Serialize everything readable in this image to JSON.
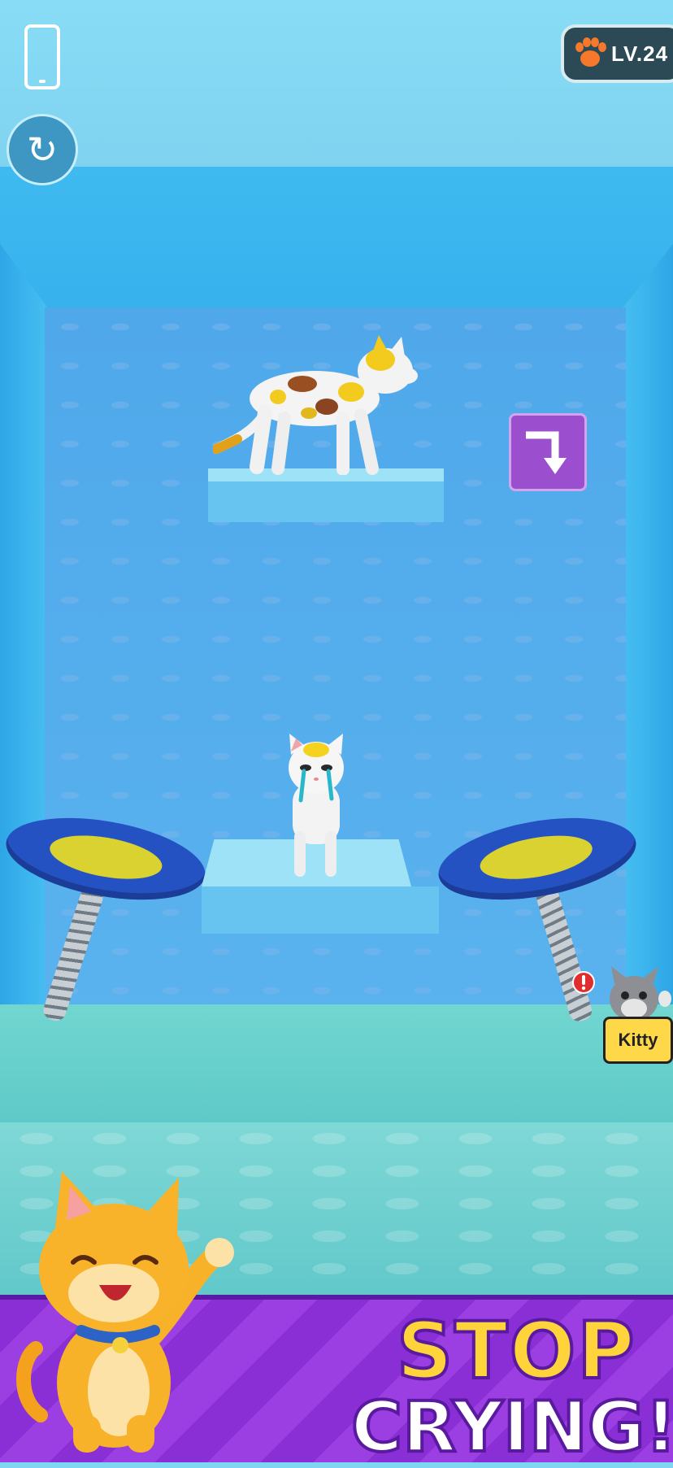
{
  "hud": {
    "orientation_icon": "phone-portrait-icon",
    "restart_icon": "restart-icon",
    "level_icon": "paw-icon",
    "level_label": "LV.24"
  },
  "scene": {
    "direction_tile_icon": "turn-down-arrow-icon",
    "player_cat": "calico-cat",
    "crying_cat": "white-crying-cat",
    "left_trampoline": "trampoline",
    "right_trampoline": "trampoline",
    "floor": "water",
    "colors": {
      "wall": "#4fa8ea",
      "water": "#6fd3cf",
      "trampoline_rim": "#2552c2",
      "trampoline_pad": "#d9d230",
      "tile": "#9b4fcf"
    }
  },
  "notification": {
    "alert_icon": "exclamation-icon",
    "name_label": "Kitty"
  },
  "banner": {
    "line1": "STOP",
    "line2": "CRYING!",
    "mascot": "orange-cartoon-cat",
    "colors": {
      "stripe": "#8a2fd6",
      "line1": "#ffd43a",
      "line2": "#ffffff"
    }
  }
}
